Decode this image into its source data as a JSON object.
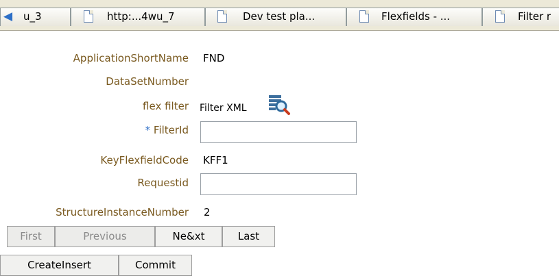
{
  "tabs": [
    {
      "label": "u_3"
    },
    {
      "label": "http:...4wu_7"
    },
    {
      "label": "Dev test pla..."
    },
    {
      "label": "Flexfields - ..."
    },
    {
      "label": "Filter r"
    }
  ],
  "form": {
    "application_short_name": {
      "label": "ApplicationShortName",
      "value": "FND"
    },
    "data_set_number": {
      "label": "DataSetNumber",
      "value": ""
    },
    "flex_filter": {
      "label": "flex filter",
      "value": "Filter XML"
    },
    "filter_id": {
      "required_marker": "*",
      "label": "FilterId",
      "value": ""
    },
    "key_flexfield_code": {
      "label": "KeyFlexfieldCode",
      "value": "KFF1"
    },
    "request_id": {
      "label": "Requestid",
      "value": ""
    },
    "structure_instance_number": {
      "label": "StructureInstanceNumber",
      "value": "2"
    }
  },
  "nav_buttons": {
    "first": "First",
    "previous": "Previous",
    "next": "Ne&xt",
    "last": "Last"
  },
  "action_buttons": {
    "create_insert": "CreateInsert",
    "commit": "Commit"
  },
  "icons": {
    "back": "back-arrow-icon",
    "document": "document-icon",
    "filter": "filter-search-icon"
  },
  "colors": {
    "label": "#7a5a20",
    "required_marker": "#2f6fc7",
    "disabled_text": "#8b8b8b"
  }
}
